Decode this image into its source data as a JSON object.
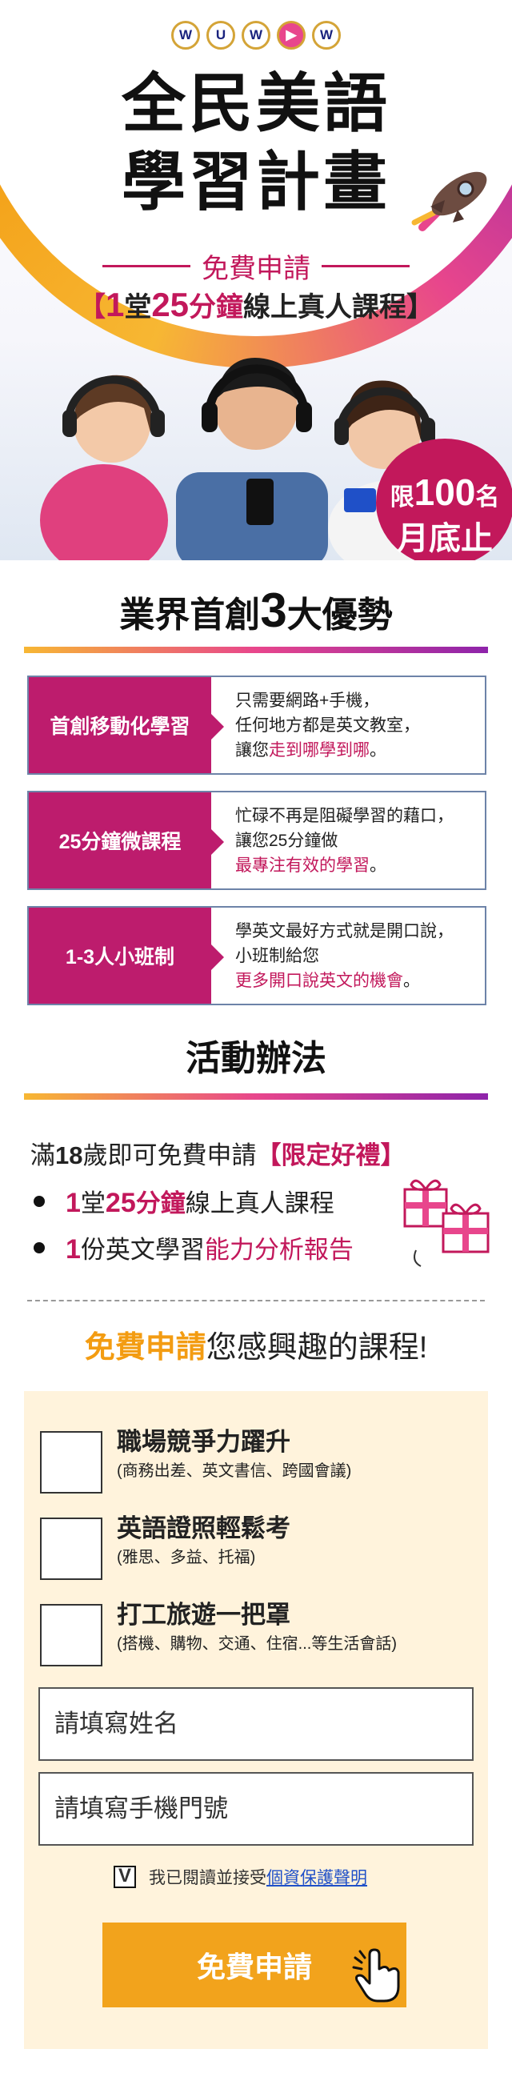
{
  "hero": {
    "logo_letters": [
      "W",
      "U",
      "W",
      "▶",
      "W"
    ],
    "title_line1": "全民美語",
    "title_line2": "學習計畫",
    "free_apply": "免費申請",
    "course_prefix": "【",
    "course_num1": "1",
    "course_mid1": "堂",
    "course_num2": "25",
    "course_mid2": "分鐘",
    "course_suffix": "線上真人課程】",
    "badge_limit": "限",
    "badge_count": "100",
    "badge_unit": "名",
    "badge_deadline": "月底止"
  },
  "advantages": {
    "heading_pre": "業界首創",
    "heading_num": "3",
    "heading_post": "大優勢",
    "items": [
      {
        "label": "首創移動化學習",
        "line1": "只需要網路+手機，",
        "line2": "任何地方都是英文教室，",
        "line3_plain": "讓您",
        "line3_pink": "走到哪學到哪",
        "line3_end": "。"
      },
      {
        "label": "25分鐘微課程",
        "line1": "忙碌不再是阻礙學習的藉口，",
        "line2": "讓您25分鐘做",
        "line3_plain": "",
        "line3_pink": "最專注有效的學習",
        "line3_end": "。"
      },
      {
        "label": "1-3人小班制",
        "line1": "學英文最好方式就是開口說，",
        "line2": "小班制給您",
        "line3_plain": "",
        "line3_pink": "更多開口說英文的機會",
        "line3_end": "。"
      }
    ]
  },
  "activity": {
    "heading": "活動辦法",
    "line_pre": "滿",
    "line_num": "18",
    "line_mid": "歲即可免費申請",
    "line_gift": "【限定好禮】",
    "b1_num1": "1",
    "b1_t1": "堂",
    "b1_num2": "25",
    "b1_t2": "分鐘",
    "b1_t3": "線上真人課程",
    "b2_num": "1",
    "b2_t1": "份英文學習",
    "b2_pink": "能力分析報告",
    "apply_or": "免費申請",
    "apply_rest": "您感興趣的課程!"
  },
  "form": {
    "options": [
      {
        "title": "職場競爭力躍升",
        "sub": "(商務出差、英文書信、跨國會議)"
      },
      {
        "title": "英語證照輕鬆考",
        "sub": "(雅思、多益、托福)"
      },
      {
        "title": "打工旅遊一把罩",
        "sub": "(搭機、購物、交通、住宿...等生活會話)"
      }
    ],
    "name_placeholder": "請填寫姓名",
    "phone_placeholder": "請填寫手機門號",
    "agree_check": "V",
    "agree_text": "我已閱讀並接受",
    "agree_link": "個資保護聲明",
    "submit_label": "免費申請"
  },
  "colors": {
    "pink": "#c2185b",
    "magenta_label": "#bd1c6d",
    "orange": "#f2a31c",
    "link": "#1f50c8"
  }
}
